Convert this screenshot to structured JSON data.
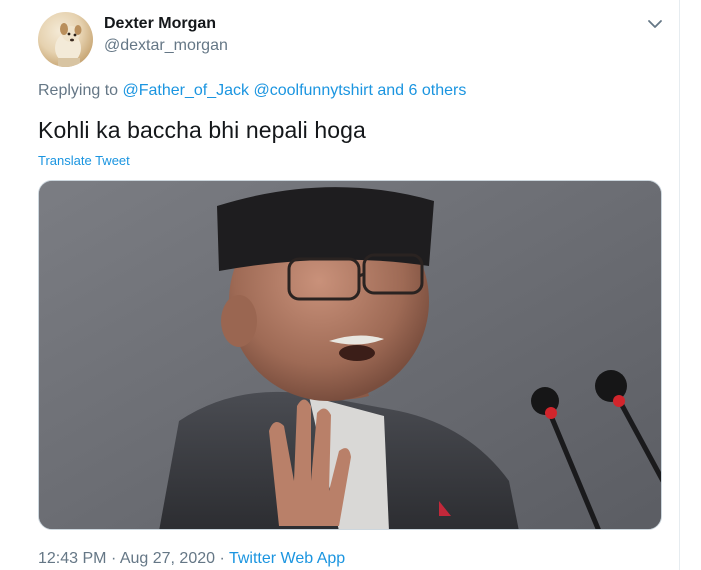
{
  "author": {
    "display_name": "Dexter Morgan",
    "handle": "@dextar_morgan",
    "avatar_icon": "dog-avatar-photo"
  },
  "menu": {
    "icon": "chevron-down-icon"
  },
  "reply": {
    "prefix": "Replying to",
    "mention_1": "@Father_of_Jack",
    "mention_2": "@coolfunnytshirt",
    "and_word": "and",
    "others": "6 others"
  },
  "tweet": {
    "text": "Kohli ka baccha bhi nepali hoga",
    "translate_label": "Translate Tweet"
  },
  "media": {
    "description_icon": "photo-man-speaking-at-microphones"
  },
  "meta": {
    "time": "12:43 PM",
    "separator": "·",
    "date": "Aug 27, 2020",
    "source": "Twitter Web App"
  },
  "colors": {
    "link": "#1b95e0",
    "secondary_text": "#657786",
    "primary_text": "#14171a"
  }
}
